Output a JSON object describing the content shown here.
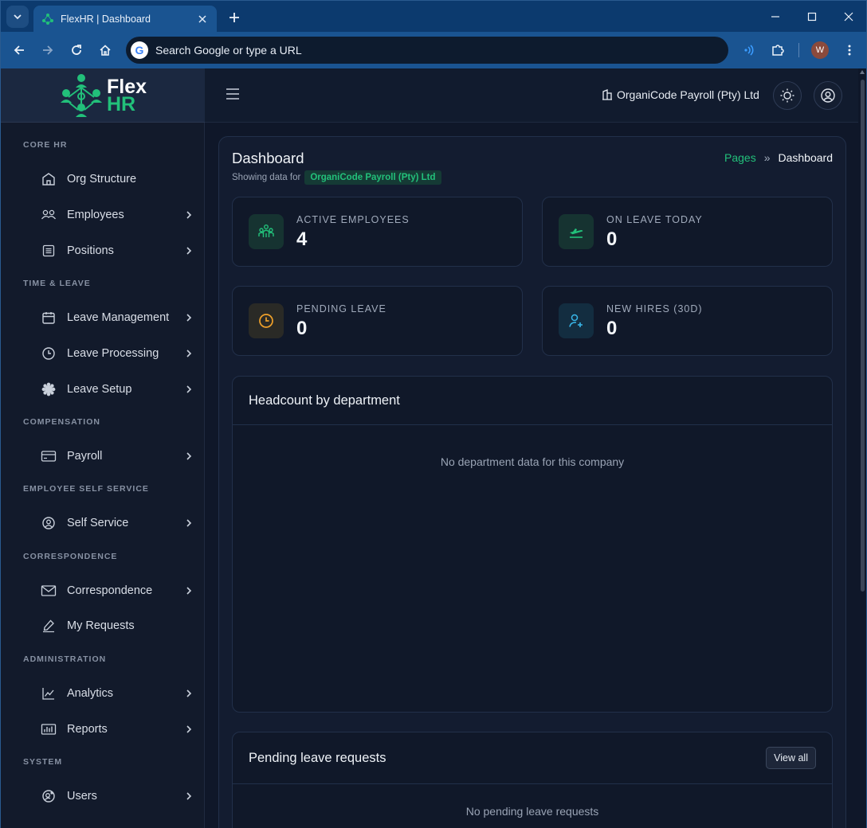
{
  "browser": {
    "tab_title": "FlexHR | Dashboard",
    "omnibox_placeholder": "Search Google or type a URL",
    "profile_initial": "W"
  },
  "app": {
    "logo_line1": "Flex",
    "logo_line2": "HR",
    "company_name": "OrganiCode Payroll (Pty) Ltd"
  },
  "sidebar": {
    "sections": [
      {
        "label": "CORE HR",
        "items": [
          {
            "label": "Org Structure",
            "icon": "building-icon",
            "has_children": false
          },
          {
            "label": "Employees",
            "icon": "users-icon",
            "has_children": true
          },
          {
            "label": "Positions",
            "icon": "list-icon",
            "has_children": true
          }
        ]
      },
      {
        "label": "TIME & LEAVE",
        "items": [
          {
            "label": "Leave Management",
            "icon": "calendar-icon",
            "has_children": true
          },
          {
            "label": "Leave Processing",
            "icon": "clock-icon",
            "has_children": true
          },
          {
            "label": "Leave Setup",
            "icon": "cog-icon",
            "has_children": true
          }
        ]
      },
      {
        "label": "COMPENSATION",
        "items": [
          {
            "label": "Payroll",
            "icon": "credit-card-icon",
            "has_children": true
          }
        ]
      },
      {
        "label": "EMPLOYEE SELF SERVICE",
        "items": [
          {
            "label": "Self Service",
            "icon": "user-circle-icon",
            "has_children": true
          }
        ]
      },
      {
        "label": "CORRESPONDENCE",
        "items": [
          {
            "label": "Correspondence",
            "icon": "mail-icon",
            "has_children": true
          },
          {
            "label": "My Requests",
            "icon": "pen-icon",
            "has_children": false
          }
        ]
      },
      {
        "label": "ADMINISTRATION",
        "items": [
          {
            "label": "Analytics",
            "icon": "chart-line-icon",
            "has_children": true
          },
          {
            "label": "Reports",
            "icon": "bar-chart-icon",
            "has_children": true
          }
        ]
      },
      {
        "label": "SYSTEM",
        "items": [
          {
            "label": "Users",
            "icon": "user-cog-icon",
            "has_children": true
          }
        ]
      }
    ]
  },
  "page": {
    "title": "Dashboard",
    "showing_prefix": "Showing data for",
    "company_pill": "OrganiCode Payroll (Pty) Ltd",
    "breadcrumb": {
      "parent": "Pages",
      "separator": "»",
      "current": "Dashboard"
    }
  },
  "stats": [
    {
      "label": "ACTIVE EMPLOYEES",
      "value": "4",
      "icon": "people-icon",
      "color": "#22c07a"
    },
    {
      "label": "ON LEAVE TODAY",
      "value": "0",
      "icon": "plane-departure-icon",
      "color": "#22c07a"
    },
    {
      "label": "PENDING LEAVE",
      "value": "0",
      "icon": "clock-icon",
      "color": "#f0a12a"
    },
    {
      "label": "NEW HIRES (30D)",
      "value": "0",
      "icon": "user-plus-icon",
      "color": "#38b6e8"
    }
  ],
  "headcount": {
    "title": "Headcount by department",
    "empty": "No department data for this company"
  },
  "pending_requests": {
    "title": "Pending leave requests",
    "view_all": "View all",
    "empty": "No pending leave requests"
  },
  "colors": {
    "accent": "#22c07a",
    "warning": "#f0a12a",
    "info": "#38b6e8",
    "background": "#0f1729"
  }
}
